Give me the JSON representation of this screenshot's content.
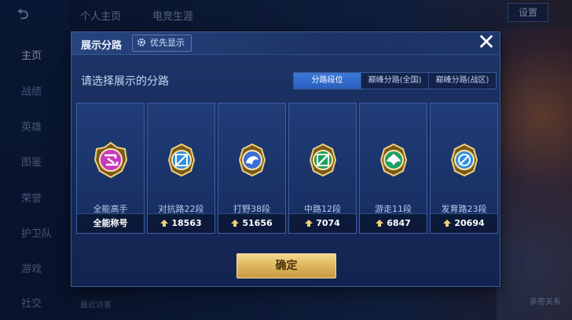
{
  "background": {
    "nav": [
      "主页",
      "战绩",
      "英雄",
      "图鉴",
      "荣誉",
      "护卫队",
      "游戏",
      "社交"
    ],
    "tabs": [
      "个人主页",
      "电竞生涯"
    ],
    "settings_label": "设置",
    "bottom_left_text": "最近访客",
    "bottom_right_text": "亲密关系"
  },
  "dialog": {
    "title": "展示分路",
    "priority_label": "优先显示",
    "close_icon": "close-icon",
    "prompt": "请选择展示的分路",
    "segments": [
      {
        "label": "分路段位",
        "active": true
      },
      {
        "label": "巅峰分路(全国)",
        "active": false
      },
      {
        "label": "巅峰分路(战区)",
        "active": false
      }
    ],
    "cards": [
      {
        "label": "全能高手",
        "footer": "全能称号",
        "badge": "allround-badge-icon",
        "color": "#c63bbd"
      },
      {
        "label": "对抗路22段",
        "footer": "18563",
        "badge": "clash-lane-badge-icon",
        "color": "#2f8fe0"
      },
      {
        "label": "打野38段",
        "footer": "51656",
        "badge": "jungle-badge-icon",
        "color": "#3a6fd8"
      },
      {
        "label": "中路12段",
        "footer": "7074",
        "badge": "mid-lane-badge-icon",
        "color": "#1f9e5a"
      },
      {
        "label": "游走11段",
        "footer": "6847",
        "badge": "roam-badge-icon",
        "color": "#1f9e6a"
      },
      {
        "label": "发育路23段",
        "footer": "20694",
        "badge": "farm-lane-badge-icon",
        "color": "#2f8fe0"
      }
    ],
    "confirm_label": "确定"
  }
}
